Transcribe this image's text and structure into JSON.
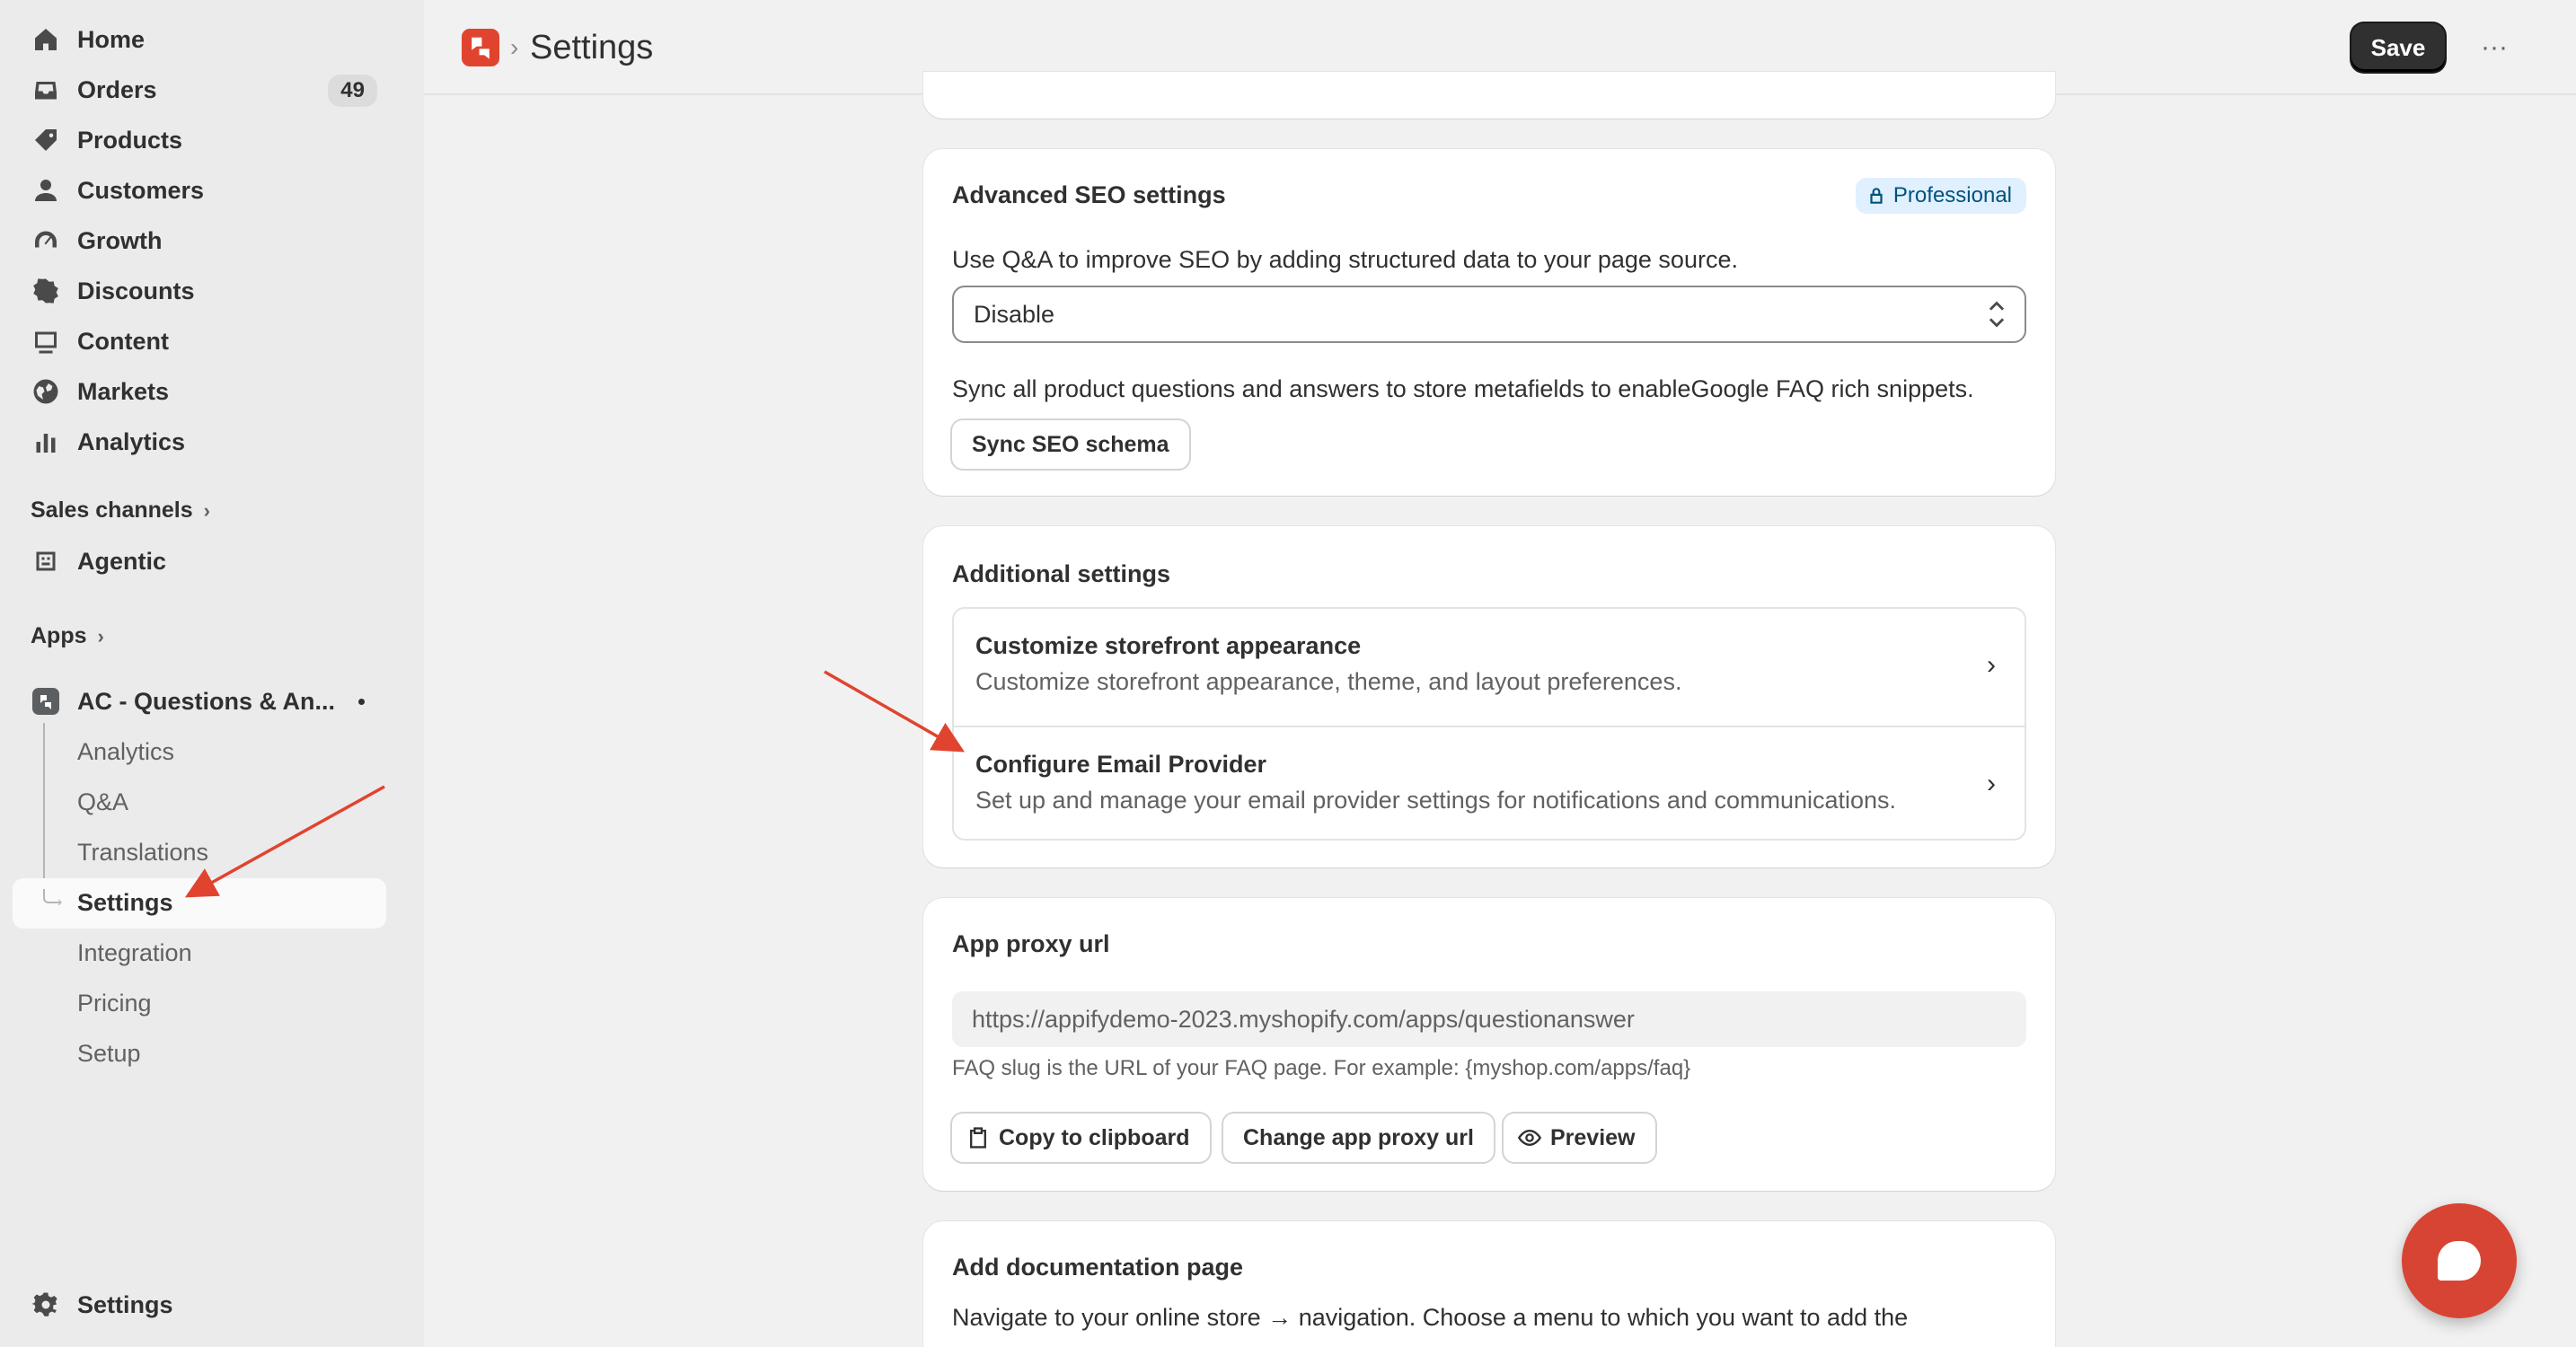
{
  "sidebar": {
    "nav": [
      {
        "label": "Home",
        "icon": "home-icon"
      },
      {
        "label": "Orders",
        "icon": "orders-icon",
        "badge": "49"
      },
      {
        "label": "Products",
        "icon": "tag-icon"
      },
      {
        "label": "Customers",
        "icon": "person-icon"
      },
      {
        "label": "Growth",
        "icon": "gauge-icon"
      },
      {
        "label": "Discounts",
        "icon": "discount-icon"
      },
      {
        "label": "Content",
        "icon": "content-icon"
      },
      {
        "label": "Markets",
        "icon": "globe-icon"
      },
      {
        "label": "Analytics",
        "icon": "bar-chart-icon"
      }
    ],
    "sales_channels": "Sales channels",
    "agentic": "Agentic",
    "apps": "Apps",
    "app_name": "AC - Questions & An...",
    "app_sub": [
      "Analytics",
      "Q&A",
      "Translations",
      "Settings",
      "Integration",
      "Pricing",
      "Setup"
    ],
    "settings": "Settings"
  },
  "header": {
    "title": "Settings",
    "save_label": "Save",
    "more_label": "···"
  },
  "seo_card": {
    "title": "Advanced SEO settings",
    "badge": "Professional",
    "description": "Use Q&A to improve SEO by adding structured data to your page source.",
    "select_value": "Disable",
    "sync_text": "Sync all product questions and answers to store metafields to enableGoogle FAQ rich snippets.",
    "sync_button": "Sync SEO schema"
  },
  "additional_card": {
    "title": "Additional settings",
    "rows": [
      {
        "title": "Customize storefront appearance",
        "desc": "Customize storefront appearance, theme, and layout preferences."
      },
      {
        "title": "Configure Email Provider",
        "desc": "Set up and manage your email provider settings for notifications and communications."
      }
    ]
  },
  "proxy_card": {
    "title": "App proxy url",
    "url": "https://appifydemo-2023.myshopify.com/apps/questionanswer",
    "helper": "FAQ slug is the URL of your FAQ page. For example: {myshop.com/apps/faq}",
    "copy_button": "Copy to clipboard",
    "change_button": "Change app proxy url",
    "preview_button": "Preview"
  },
  "doc_card": {
    "title": "Add documentation page",
    "text": "Navigate to your online store → navigation. Choose a menu to which you want to add the"
  },
  "colors": {
    "accent_arrow": "#e0442f",
    "fab": "#d84433",
    "primary_button": "#303030"
  }
}
